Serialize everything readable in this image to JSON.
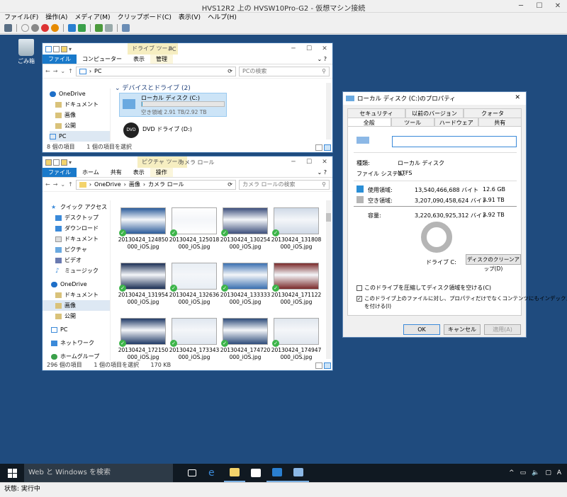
{
  "host": {
    "title": "HVS12R2 上の HVSW10Pro-G2 - 仮想マシン接続",
    "menu": [
      "ファイル(F)",
      "操作(A)",
      "メディア(M)",
      "クリップボード(C)",
      "表示(V)",
      "ヘルプ(H)"
    ],
    "status_text": "状態: 実行中"
  },
  "desktop": {
    "recycle_bin_label": "ごみ箱"
  },
  "pc_window": {
    "context_tab": "ドライブ ツール",
    "title": "PC",
    "tabs": [
      "ファイル",
      "コンピューター",
      "表示",
      "管理"
    ],
    "address": "PC",
    "search_placeholder": "PCの検索",
    "nav": [
      "OneDrive",
      "ドキュメント",
      "画像",
      "公開",
      "PC"
    ],
    "group_header": "デバイスとドライブ (2)",
    "drives": [
      {
        "name": "ローカル ディスク (C:)",
        "free": "空き領域 2.91 TB/2.92 TB",
        "used_fraction": 0.004
      },
      {
        "name": "DVD ドライブ (D:)",
        "free": ""
      }
    ],
    "status_count": "8 個の項目",
    "status_selected": "1 個の項目を選択"
  },
  "camera_window": {
    "context_tab": "ピクチャ ツール",
    "title": "カメラ ロール",
    "tabs": [
      "ファイル",
      "ホーム",
      "共有",
      "表示",
      "操作"
    ],
    "breadcrumb": [
      "OneDrive",
      "画像",
      "カメラ ロール"
    ],
    "search_placeholder": "カメラ ロールの検索",
    "nav": [
      "クイック アクセス",
      "デスクトップ",
      "ダウンロード",
      "ドキュメント",
      "ピクチャ",
      "ビデオ",
      "ミュージック",
      "OneDrive",
      "ドキュメント",
      "画像",
      "公開",
      "PC",
      "ネットワーク",
      "ホームグループ"
    ],
    "files": [
      {
        "l1": "20130424_124850",
        "l2": "000_iOS.jpg"
      },
      {
        "l1": "20130424_125018",
        "l2": "000_iOS.jpg"
      },
      {
        "l1": "20130424_130254",
        "l2": "000_iOS.jpg"
      },
      {
        "l1": "20130424_131808",
        "l2": "000_iOS.jpg"
      },
      {
        "l1": "20130424_131954",
        "l2": "000_iOS.jpg"
      },
      {
        "l1": "20130424_132636",
        "l2": "000_iOS.jpg"
      },
      {
        "l1": "20130424_133333",
        "l2": "000_iOS.jpg"
      },
      {
        "l1": "20130424_171122",
        "l2": "000_iOS.jpg"
      },
      {
        "l1": "20130424_172150",
        "l2": "000_iOS.jpg"
      },
      {
        "l1": "20130424_173343",
        "l2": "000_iOS.jpg"
      },
      {
        "l1": "20130424_174720",
        "l2": "000_iOS.jpg"
      },
      {
        "l1": "20130424_174947",
        "l2": "000_iOS.jpg"
      }
    ],
    "status_count": "296 個の項目",
    "status_selected": "1 個の項目を選択",
    "status_size": "170 KB"
  },
  "props": {
    "title": "ローカル ディスク (C:)のプロパティ",
    "tabs_row1": [
      "セキュリティ",
      "以前のバージョン",
      "クォータ"
    ],
    "tabs_row2": [
      "全般",
      "ツール",
      "ハードウェア",
      "共有"
    ],
    "name_value": "",
    "type_label": "種類:",
    "type_value": "ローカル ディスク",
    "fs_label": "ファイル システム:",
    "fs_value": "NTFS",
    "used_label": "使用領域:",
    "used_bytes": "13,540,466,688 バイト",
    "used_size": "12.6 GB",
    "free_label": "空き領域:",
    "free_bytes": "3,207,090,458,624 バイト",
    "free_size": "2.91 TB",
    "cap_label": "容量:",
    "cap_bytes": "3,220,630,925,312 バイト",
    "cap_size": "2.92 TB",
    "drive_label": "ドライブ C:",
    "cleanup_button": "ディスクのクリーンアップ(D)",
    "compress_label": "このドライブを圧縮してディスク領域を空ける(C)",
    "index_label_1": "このドライブ上のファイルに対し、プロパティだけでなくコンテンツにもインデックス",
    "index_label_2": "を付ける(I)",
    "ok": "OK",
    "cancel": "キャンセル",
    "apply": "適用(A)"
  },
  "taskbar": {
    "search_placeholder": "Web と Windows を検索"
  },
  "colors": {
    "desktop": "#1f4b7e",
    "used": "#2b8fd6",
    "free": "#b5b5b5",
    "accent": "#1979ca"
  }
}
